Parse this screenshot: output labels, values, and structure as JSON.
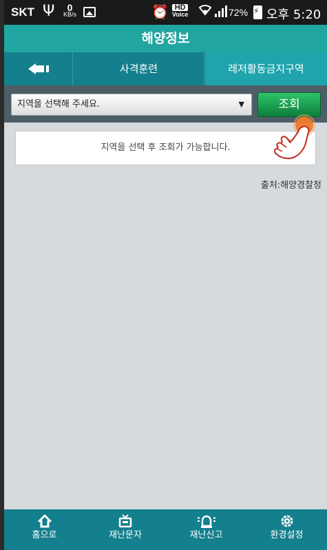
{
  "status_bar": {
    "carrier": "SKT",
    "data_rate_value": "0",
    "data_rate_unit": "KB/s",
    "hd_label": "HD",
    "voice_label": "Voice",
    "battery_percent": "72%",
    "clock": "오후 5:20",
    "icons": [
      "usb-icon",
      "image-icon",
      "alarm-icon",
      "wifi-icon",
      "signal-icon",
      "battery-icon"
    ]
  },
  "header": {
    "title": "해양정보"
  },
  "tabs": {
    "back_icon": "back-arrow-icon",
    "items": [
      {
        "label": "사격훈련",
        "active": false
      },
      {
        "label": "레저활동금지구역",
        "active": true
      }
    ]
  },
  "filter": {
    "region_select_value": "지역을 선택해 주세요.",
    "search_button_label": "조회"
  },
  "main": {
    "message": "지역을 선택 후 조회가 가능합니다.",
    "source": "출처:해양경찰청"
  },
  "bottom_nav": {
    "items": [
      {
        "label": "홈으로",
        "icon": "home-icon"
      },
      {
        "label": "재난문자",
        "icon": "tv-icon"
      },
      {
        "label": "재난신고",
        "icon": "siren-icon"
      },
      {
        "label": "환경설정",
        "icon": "gear-icon"
      }
    ]
  },
  "colors": {
    "title_bar": "#21a5a0",
    "tab_bar": "#147f8d",
    "active_tab": "#1fa4ad",
    "filter_bar": "#4d5e66",
    "search_button": "#1a9a4f",
    "content_bg": "#d6dadc",
    "tap_indicator": "#f07a2a"
  }
}
